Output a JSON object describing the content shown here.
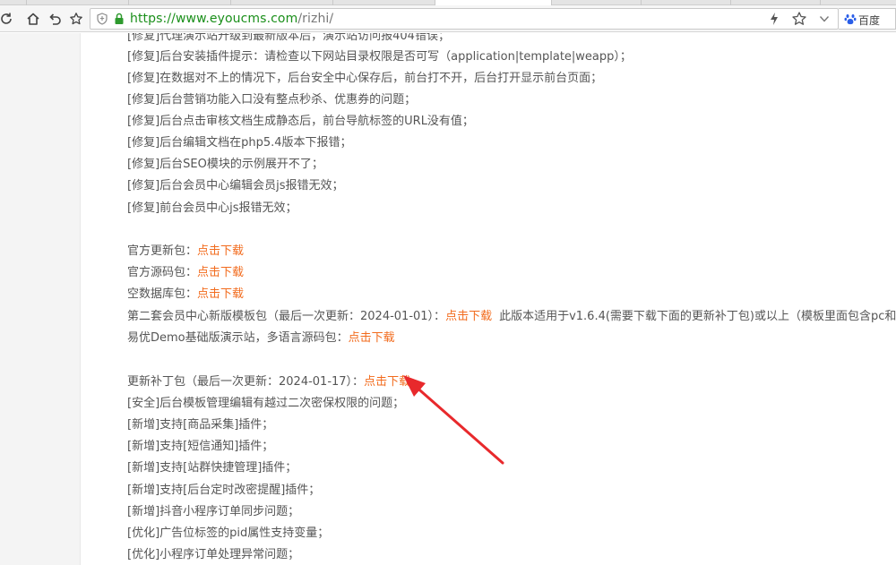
{
  "browser": {
    "url_scheme": "https://",
    "url_host": "www.eyoucms.com",
    "url_path": "/rizhi/",
    "search_engine": "百度",
    "icons": [
      "refresh-icon",
      "home-icon",
      "undo-icon",
      "star-icon",
      "shield-icon",
      "lock-icon",
      "bolt-icon",
      "chevron-down-icon",
      "baidu-paw-icon"
    ]
  },
  "fixes": [
    "[修复]代理演示站升级到最新版本后，演示站访问报404错误；",
    "[修复]后台安装插件提示：请检查以下网站目录权限是否可写（application|template|weapp）；",
    "[修复]在数据对不上的情况下，后台安全中心保存后，前台打不开，后台打开显示前台页面；",
    "[修复]后台营销功能入口没有整点秒杀、优惠券的问题；",
    "[修复]后台点击审核文档生成静态后，前台导航标签的URL没有值；",
    "[修复]后台编辑文档在php5.4版本下报错；",
    "[修复]后台SEO模块的示例展开不了；",
    "[修复]后台会员中心编辑会员js报错无效；",
    "[修复]前台会员中心js报错无效；"
  ],
  "downloads": {
    "official_update_label": "官方更新包：",
    "official_source_label": "官方源码包：",
    "empty_db_label": "空数据库包：",
    "member_template_label": "第二套会员中心新版模板包（最后一次更新：2024-01-01）：",
    "member_template_note": "此版本适用于v1.6.4(需要下载下面的更新补丁包)或以上（模板里面包含pc和m",
    "demo_label": "易优Demo基础版演示站，多语言源码包：",
    "link_text": "点击下载"
  },
  "patch": {
    "label": "更新补丁包（最后一次更新：2024-01-17）：",
    "link_text": "点击下载",
    "items": [
      "[安全]后台模板管理编辑有越过二次密保权限的问题；",
      "[新增]支持[商品采集]插件；",
      "[新增]支持[短信通知]插件；",
      "[新增]支持[站群快捷管理]插件；",
      "[新增]支持[后台定时改密提醒]插件；",
      "[新增]抖音小程序订单同步问题；",
      "[优化]广告位标签的pid属性支持变量；",
      "[优化]小程序订单处理异常问题；"
    ]
  },
  "colors": {
    "link": "#f26b1d",
    "text": "#555555",
    "url_green": "#1a8f1a",
    "arrow": "#e8292c"
  }
}
